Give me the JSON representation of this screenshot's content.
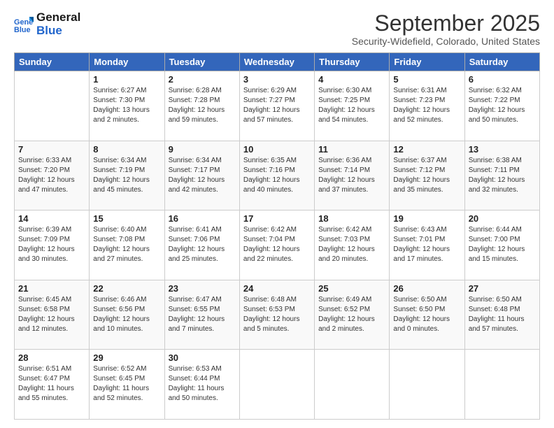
{
  "logo": {
    "line1": "General",
    "line2": "Blue"
  },
  "title": "September 2025",
  "subtitle": "Security-Widefield, Colorado, United States",
  "headers": [
    "Sunday",
    "Monday",
    "Tuesday",
    "Wednesday",
    "Thursday",
    "Friday",
    "Saturday"
  ],
  "weeks": [
    [
      {
        "day": "",
        "info": ""
      },
      {
        "day": "1",
        "info": "Sunrise: 6:27 AM\nSunset: 7:30 PM\nDaylight: 13 hours\nand 2 minutes."
      },
      {
        "day": "2",
        "info": "Sunrise: 6:28 AM\nSunset: 7:28 PM\nDaylight: 12 hours\nand 59 minutes."
      },
      {
        "day": "3",
        "info": "Sunrise: 6:29 AM\nSunset: 7:27 PM\nDaylight: 12 hours\nand 57 minutes."
      },
      {
        "day": "4",
        "info": "Sunrise: 6:30 AM\nSunset: 7:25 PM\nDaylight: 12 hours\nand 54 minutes."
      },
      {
        "day": "5",
        "info": "Sunrise: 6:31 AM\nSunset: 7:23 PM\nDaylight: 12 hours\nand 52 minutes."
      },
      {
        "day": "6",
        "info": "Sunrise: 6:32 AM\nSunset: 7:22 PM\nDaylight: 12 hours\nand 50 minutes."
      }
    ],
    [
      {
        "day": "7",
        "info": "Sunrise: 6:33 AM\nSunset: 7:20 PM\nDaylight: 12 hours\nand 47 minutes."
      },
      {
        "day": "8",
        "info": "Sunrise: 6:34 AM\nSunset: 7:19 PM\nDaylight: 12 hours\nand 45 minutes."
      },
      {
        "day": "9",
        "info": "Sunrise: 6:34 AM\nSunset: 7:17 PM\nDaylight: 12 hours\nand 42 minutes."
      },
      {
        "day": "10",
        "info": "Sunrise: 6:35 AM\nSunset: 7:16 PM\nDaylight: 12 hours\nand 40 minutes."
      },
      {
        "day": "11",
        "info": "Sunrise: 6:36 AM\nSunset: 7:14 PM\nDaylight: 12 hours\nand 37 minutes."
      },
      {
        "day": "12",
        "info": "Sunrise: 6:37 AM\nSunset: 7:12 PM\nDaylight: 12 hours\nand 35 minutes."
      },
      {
        "day": "13",
        "info": "Sunrise: 6:38 AM\nSunset: 7:11 PM\nDaylight: 12 hours\nand 32 minutes."
      }
    ],
    [
      {
        "day": "14",
        "info": "Sunrise: 6:39 AM\nSunset: 7:09 PM\nDaylight: 12 hours\nand 30 minutes."
      },
      {
        "day": "15",
        "info": "Sunrise: 6:40 AM\nSunset: 7:08 PM\nDaylight: 12 hours\nand 27 minutes."
      },
      {
        "day": "16",
        "info": "Sunrise: 6:41 AM\nSunset: 7:06 PM\nDaylight: 12 hours\nand 25 minutes."
      },
      {
        "day": "17",
        "info": "Sunrise: 6:42 AM\nSunset: 7:04 PM\nDaylight: 12 hours\nand 22 minutes."
      },
      {
        "day": "18",
        "info": "Sunrise: 6:42 AM\nSunset: 7:03 PM\nDaylight: 12 hours\nand 20 minutes."
      },
      {
        "day": "19",
        "info": "Sunrise: 6:43 AM\nSunset: 7:01 PM\nDaylight: 12 hours\nand 17 minutes."
      },
      {
        "day": "20",
        "info": "Sunrise: 6:44 AM\nSunset: 7:00 PM\nDaylight: 12 hours\nand 15 minutes."
      }
    ],
    [
      {
        "day": "21",
        "info": "Sunrise: 6:45 AM\nSunset: 6:58 PM\nDaylight: 12 hours\nand 12 minutes."
      },
      {
        "day": "22",
        "info": "Sunrise: 6:46 AM\nSunset: 6:56 PM\nDaylight: 12 hours\nand 10 minutes."
      },
      {
        "day": "23",
        "info": "Sunrise: 6:47 AM\nSunset: 6:55 PM\nDaylight: 12 hours\nand 7 minutes."
      },
      {
        "day": "24",
        "info": "Sunrise: 6:48 AM\nSunset: 6:53 PM\nDaylight: 12 hours\nand 5 minutes."
      },
      {
        "day": "25",
        "info": "Sunrise: 6:49 AM\nSunset: 6:52 PM\nDaylight: 12 hours\nand 2 minutes."
      },
      {
        "day": "26",
        "info": "Sunrise: 6:50 AM\nSunset: 6:50 PM\nDaylight: 12 hours\nand 0 minutes."
      },
      {
        "day": "27",
        "info": "Sunrise: 6:50 AM\nSunset: 6:48 PM\nDaylight: 11 hours\nand 57 minutes."
      }
    ],
    [
      {
        "day": "28",
        "info": "Sunrise: 6:51 AM\nSunset: 6:47 PM\nDaylight: 11 hours\nand 55 minutes."
      },
      {
        "day": "29",
        "info": "Sunrise: 6:52 AM\nSunset: 6:45 PM\nDaylight: 11 hours\nand 52 minutes."
      },
      {
        "day": "30",
        "info": "Sunrise: 6:53 AM\nSunset: 6:44 PM\nDaylight: 11 hours\nand 50 minutes."
      },
      {
        "day": "",
        "info": ""
      },
      {
        "day": "",
        "info": ""
      },
      {
        "day": "",
        "info": ""
      },
      {
        "day": "",
        "info": ""
      }
    ]
  ]
}
